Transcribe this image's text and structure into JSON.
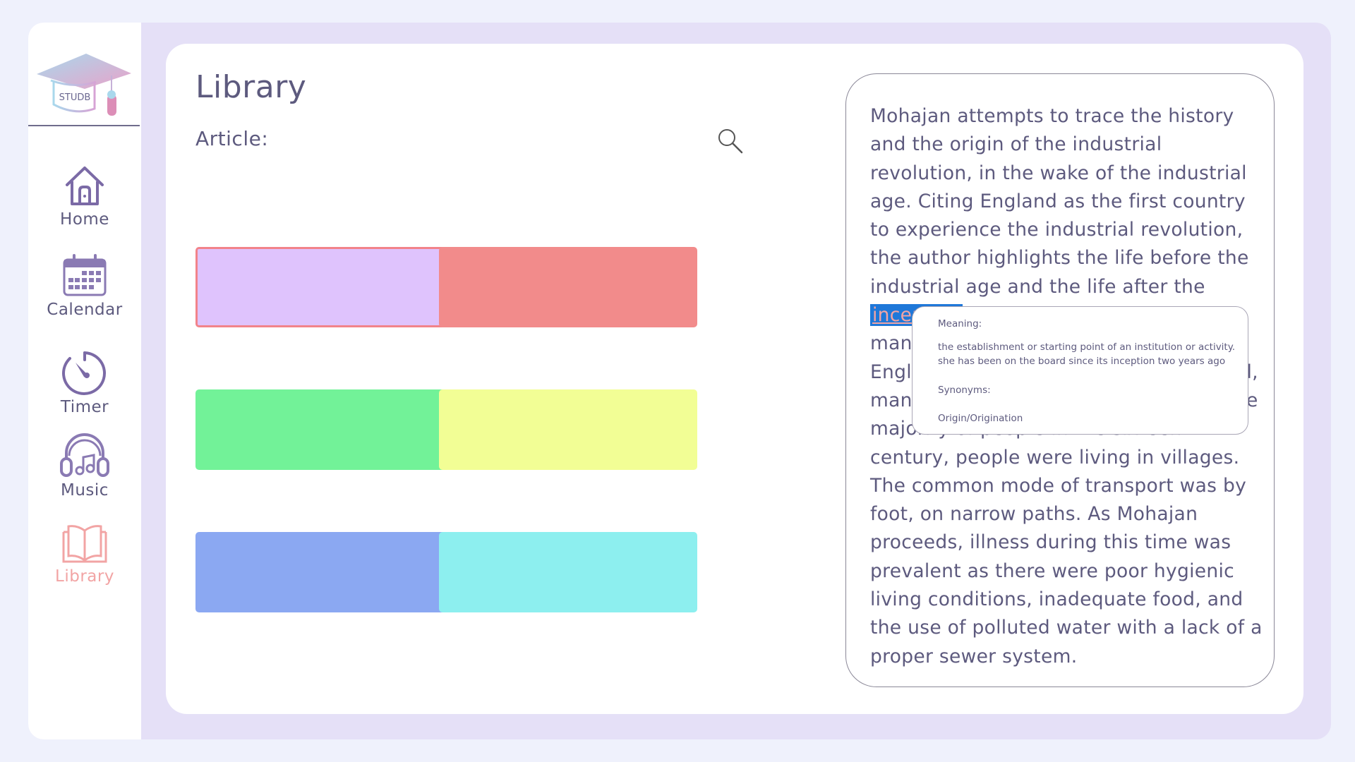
{
  "app": {
    "logo_text": "STUDB"
  },
  "sidebar": {
    "items": [
      {
        "label": "Home",
        "icon": "home-icon"
      },
      {
        "label": "Calendar",
        "icon": "calendar-icon"
      },
      {
        "label": "Timer",
        "icon": "timer-icon"
      },
      {
        "label": "Music",
        "icon": "music-headphones-icon"
      },
      {
        "label": "Library",
        "icon": "book-icon",
        "active": true
      }
    ]
  },
  "main": {
    "title": "Library",
    "article_label": "Article:",
    "search_icon": "search-icon",
    "tiles": [
      {
        "color": "#dfc3fd",
        "border": "#f2838a",
        "selected": true
      },
      {
        "color": "#f28b8b"
      },
      {
        "color": "#72f298"
      },
      {
        "color": "#f2fe95"
      },
      {
        "color": "#8ba8f2"
      },
      {
        "color": "#8defef"
      }
    ]
  },
  "reader": {
    "text_before": "Mohajan attempts to trace the history and the origin of the industrial revolution, in the wake of the industrial age. Citing England as the first country to experience the industrial revolution, the author highlights the life before the industrial age and the life after the",
    "highlighted_word": "inception",
    "text_after": "of the first machine-based manufacturing in the build-up in England. Mohajan notes that in England, manufacturing was mostly so in that the majority of people in the sixteenth century, people were living in villages. The common mode of transport was by foot, on narrow paths. As Mohajan proceeds, illness during this time was prevalent as there were poor hygienic living conditions, inadequate food, and the use of polluted water with a lack of a proper sewer system."
  },
  "definition_popup": {
    "meaning_label": "Meaning:",
    "meaning_text": "the establishment or starting point of an institution or activity.",
    "example_text": "she has been on the board since its inception two years ago",
    "synonyms_label": "Synonyms:",
    "synonyms": "Origin/Origination"
  },
  "colors": {
    "text": "#5d5a7e",
    "active_nav": "#f2a4a4",
    "highlight_bg": "#1f78d9",
    "highlight_text": "#f2a4a4",
    "frame_bg": "#e5e0f7",
    "page_bg": "#eff1fc"
  }
}
